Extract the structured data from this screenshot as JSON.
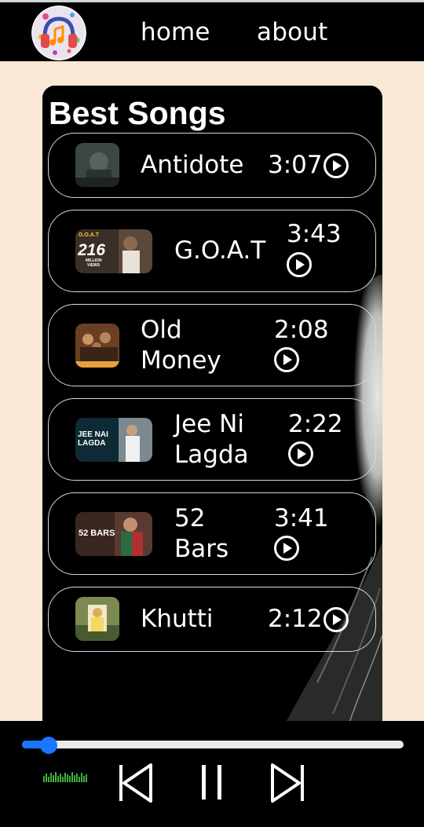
{
  "nav": {
    "home_label": "home",
    "about_label": "about"
  },
  "panel": {
    "title": "Best Songs"
  },
  "songs": [
    {
      "name": "Antidote",
      "duration": "3:07",
      "thumb_color": "#4a5a55"
    },
    {
      "name": "G.O.A.T",
      "duration": "3:43",
      "thumb_text": "216",
      "thumb_sub": "MILLION VIEWS",
      "thumb_top": "G.O.A.T",
      "thumb_color": "#2a2622"
    },
    {
      "name": "Old\nMoney",
      "duration": "2:08",
      "thumb_color": "#5a3a28"
    },
    {
      "name": "Jee Ni\nLagda",
      "duration": "2:22",
      "thumb_text": "JEE NAI\nLAGDA",
      "thumb_color": "#12303a"
    },
    {
      "name": "52\nBars",
      "duration": "3:41",
      "thumb_text": "52 BARS",
      "thumb_color": "#4a3028"
    },
    {
      "name": "Khutti",
      "duration": "2:12",
      "thumb_color": "#6a7a40"
    }
  ],
  "player": {
    "progress": 0.07,
    "accent": "#1976ff"
  },
  "colors": {
    "page_bg": "#f8e8d5",
    "bar_bg": "#000000",
    "text": "#ffffff"
  }
}
